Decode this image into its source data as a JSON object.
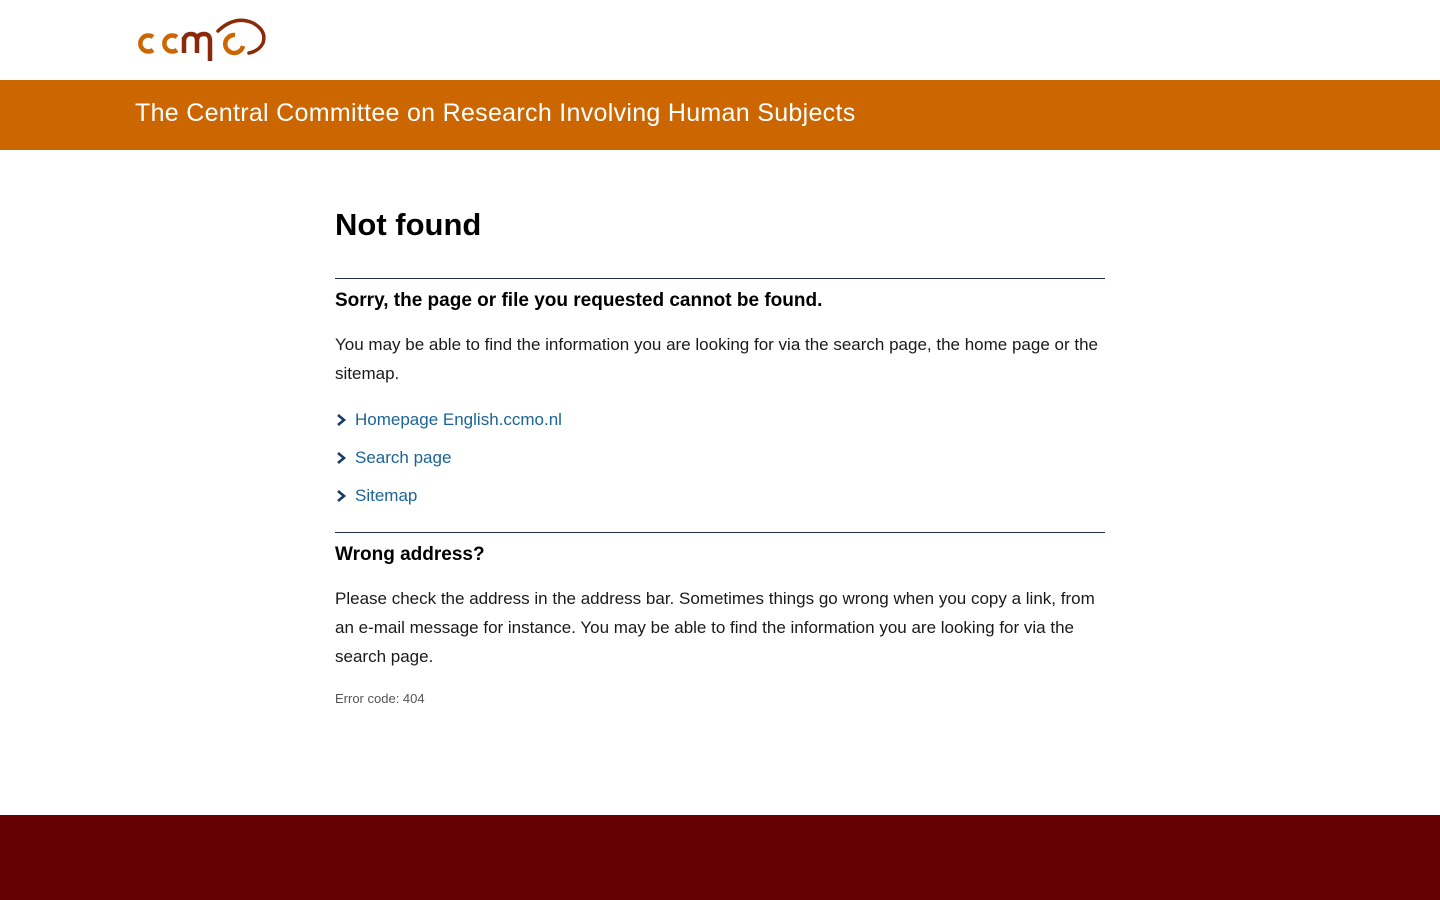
{
  "header": {
    "logo_text": "ccmo",
    "tagline": "The Central Committee on Research Involving Human Subjects"
  },
  "main": {
    "title": "Not found",
    "sorry_heading": "Sorry, the page or file you requested cannot be found.",
    "sorry_text": "You may be able to find the information you are looking for via the search page, the home page or the sitemap.",
    "links": [
      {
        "label": "Homepage English.ccmo.nl"
      },
      {
        "label": "Search page"
      },
      {
        "label": "Sitemap"
      }
    ],
    "wrong_heading": "Wrong address?",
    "wrong_text": "Please check the address in the address bar. Sometimes things go wrong when you copy a link, from an e-mail message for instance. You may be able to find the information you are looking for via the search page.",
    "error_code": "Error code: 404"
  },
  "colors": {
    "brand_orange": "#cc6600",
    "logo_dark_red": "#8b2a0a",
    "link_blue": "#1a6496",
    "footer_maroon": "#660000"
  },
  "icons": {
    "link_marker": "chevron-right-icon"
  }
}
